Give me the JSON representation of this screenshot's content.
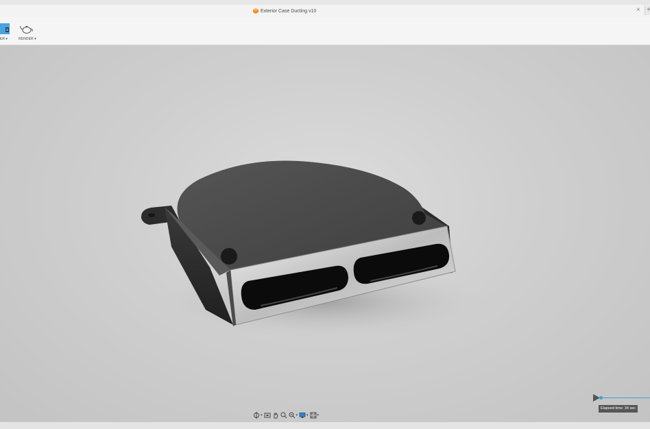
{
  "document": {
    "title": "Exterior Case Ducting v10"
  },
  "toolbar": {
    "prev_label": "ER ▾",
    "render_label": "RENDER ▾"
  },
  "playback": {
    "elapsed_text": "Elapsed time: 34 sec",
    "progress_fraction": 0.0
  },
  "icons": {
    "doc": "fusion-doc-icon",
    "close": "close-icon",
    "render": "teapot-icon",
    "orbit": "orbit-icon",
    "look": "look-at-icon",
    "pan": "pan-icon",
    "zoom": "zoom-icon",
    "fit": "fit-icon",
    "display": "display-settings-icon",
    "grid": "grid-icon",
    "play": "play-icon"
  },
  "colors": {
    "accent": "#3da3dc",
    "doc_icon": "#f28c28"
  }
}
